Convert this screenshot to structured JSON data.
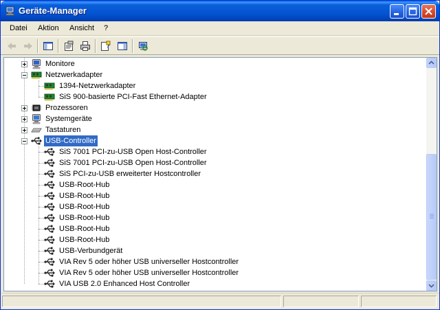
{
  "window": {
    "title": "Geräte-Manager",
    "title_icon": "computer-management-icon",
    "buttons": {
      "minimize": "minimize-icon",
      "maximize": "maximize-icon",
      "close": "close-icon"
    }
  },
  "menu": [
    "Datei",
    "Aktion",
    "Ansicht",
    "?"
  ],
  "toolbar": {
    "buttons": [
      "back-arrow-icon",
      "forward-arrow-icon",
      "show-hide-console-tree-icon",
      "properties-icon",
      "print-icon",
      "help-icon",
      "show-hide-action-pane-icon",
      "scan-hardware-icon"
    ]
  },
  "tree": {
    "nodes": [
      {
        "label": "Monitore",
        "icon": "monitor-icon",
        "level": 1,
        "expander": "plus"
      },
      {
        "label": "Netzwerkadapter",
        "icon": "network-adapter-icon",
        "level": 1,
        "expander": "minus"
      },
      {
        "label": "1394-Netzwerkadapter",
        "icon": "network-adapter-icon",
        "level": 2
      },
      {
        "label": "SiS 900-basierte PCI-Fast Ethernet-Adapter",
        "icon": "network-adapter-icon",
        "level": 2
      },
      {
        "label": "Prozessoren",
        "icon": "processor-icon",
        "level": 1,
        "expander": "plus"
      },
      {
        "label": "Systemgeräte",
        "icon": "system-device-icon",
        "level": 1,
        "expander": "plus"
      },
      {
        "label": "Tastaturen",
        "icon": "keyboard-icon",
        "level": 1,
        "expander": "plus"
      },
      {
        "label": "USB-Controller",
        "icon": "usb-icon",
        "level": 1,
        "expander": "minus",
        "selected": true
      },
      {
        "label": "SiS 7001 PCI-zu-USB Open Host-Controller",
        "icon": "usb-icon",
        "level": 2
      },
      {
        "label": "SiS 7001 PCI-zu-USB Open Host-Controller",
        "icon": "usb-icon",
        "level": 2
      },
      {
        "label": "SiS PCI-zu-USB erweiterter Hostcontroller",
        "icon": "usb-icon",
        "level": 2
      },
      {
        "label": "USB-Root-Hub",
        "icon": "usb-icon",
        "level": 2
      },
      {
        "label": "USB-Root-Hub",
        "icon": "usb-icon",
        "level": 2
      },
      {
        "label": "USB-Root-Hub",
        "icon": "usb-icon",
        "level": 2
      },
      {
        "label": "USB-Root-Hub",
        "icon": "usb-icon",
        "level": 2
      },
      {
        "label": "USB-Root-Hub",
        "icon": "usb-icon",
        "level": 2
      },
      {
        "label": "USB-Root-Hub",
        "icon": "usb-icon",
        "level": 2
      },
      {
        "label": "USB-Verbundgerät",
        "icon": "usb-icon",
        "level": 2
      },
      {
        "label": "VIA Rev 5 oder höher USB universeller Hostcontroller",
        "icon": "usb-icon",
        "level": 2
      },
      {
        "label": "VIA Rev 5 oder höher USB universeller Hostcontroller",
        "icon": "usb-icon",
        "level": 2
      },
      {
        "label": "VIA USB 2.0 Enhanced Host Controller",
        "icon": "usb-icon",
        "level": 2
      }
    ]
  },
  "colors": {
    "titlebar": "#0554d3",
    "selection": "#316ac5",
    "window_bg": "#ece9d8"
  }
}
